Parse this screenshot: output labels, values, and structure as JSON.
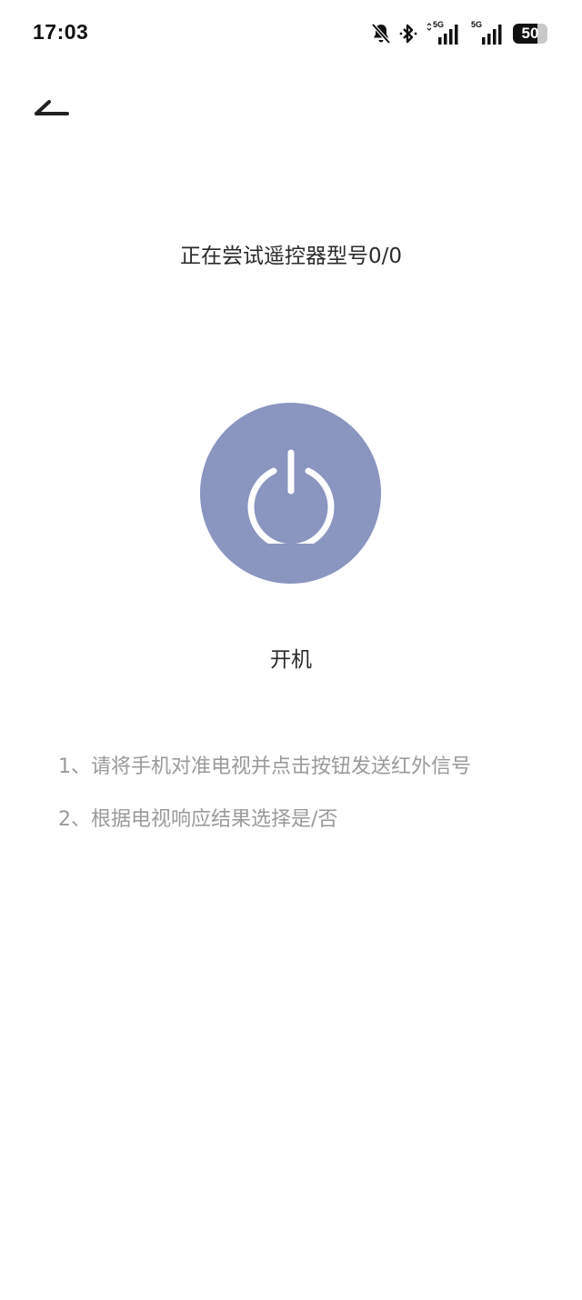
{
  "status_bar": {
    "time": "17:03",
    "network_1": "5G",
    "network_2": "5G",
    "battery_level": "50",
    "icons": [
      "bell-off-icon",
      "bluetooth-icon",
      "signal-5g-icon",
      "signal-5g-icon",
      "battery-icon"
    ]
  },
  "header": {
    "back_icon": "back-arrow-icon"
  },
  "main": {
    "title": "正在尝试遥控器型号0/0",
    "power_button_icon": "power-icon",
    "power_label": "开机",
    "power_button_color": "#8a95c0"
  },
  "instructions": [
    {
      "text": "1、请将手机对准电视并点击按钮发送红外信号"
    },
    {
      "text": "2、根据电视响应结果选择是/否"
    }
  ]
}
